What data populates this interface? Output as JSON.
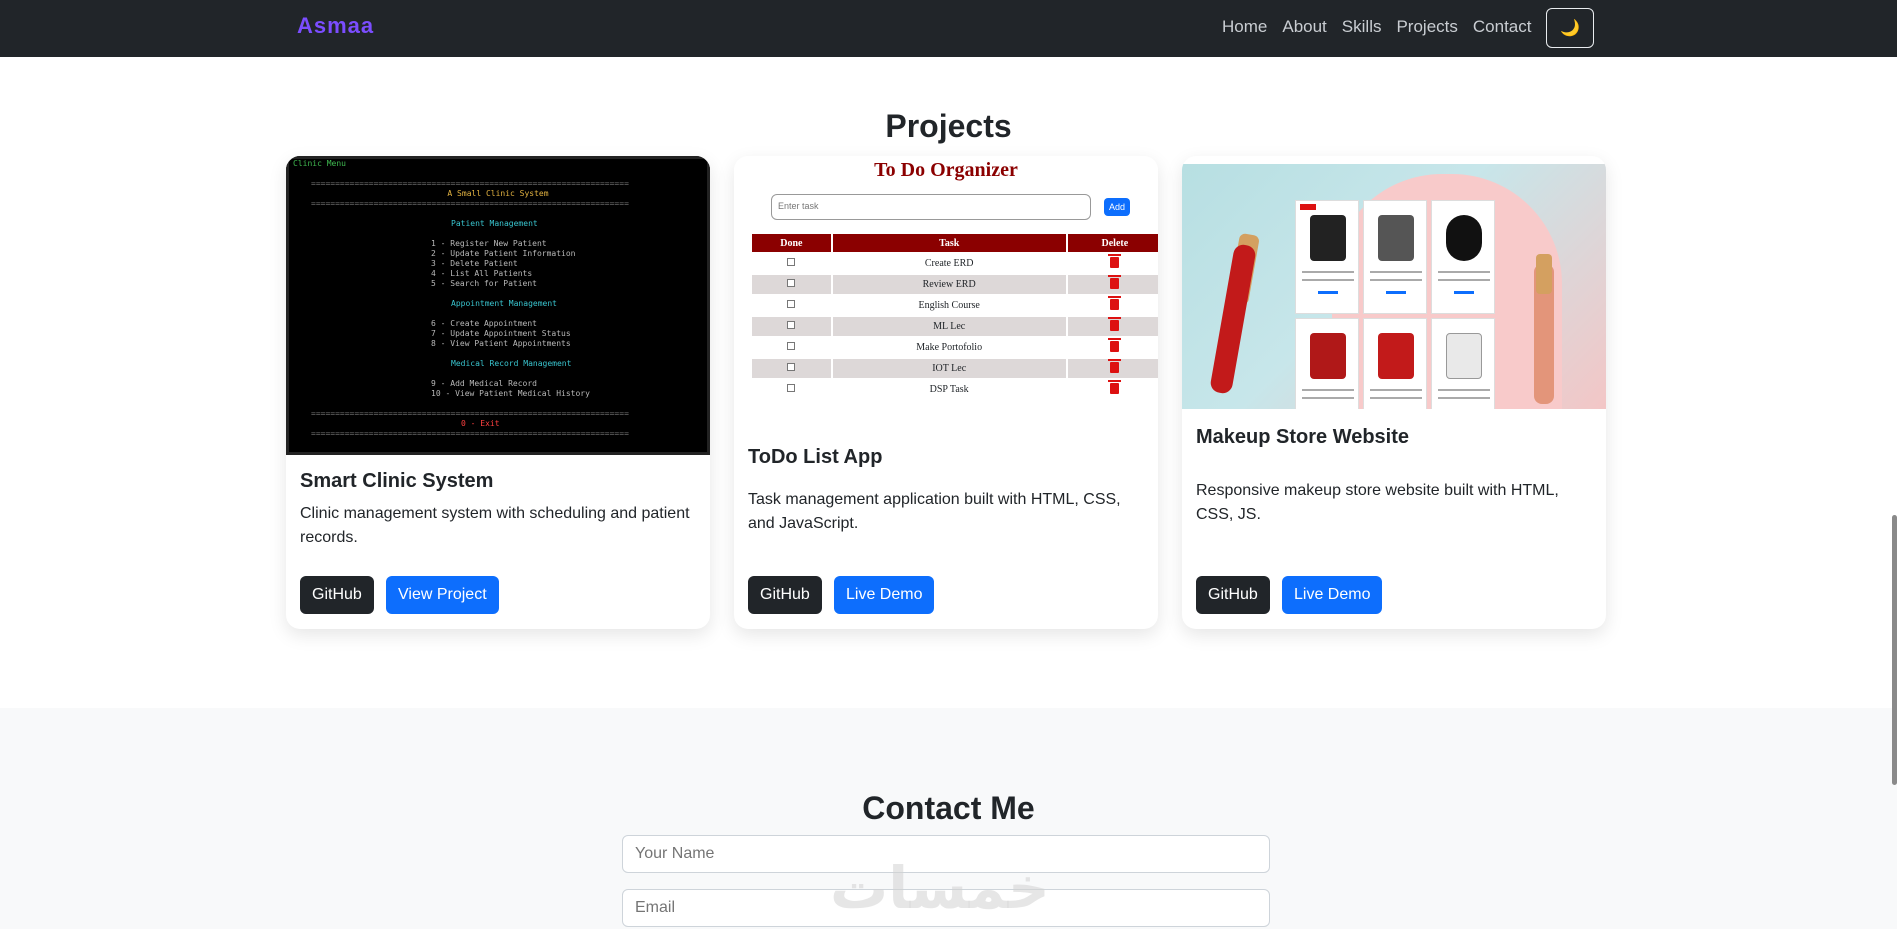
{
  "navbar": {
    "brand": "Asmaa",
    "links": [
      "Home",
      "About",
      "Skills",
      "Projects",
      "Contact"
    ],
    "theme_toggle": "🌙"
  },
  "projects": {
    "title": "Projects",
    "cards": [
      {
        "title": "Smart Clinic System",
        "text": "Clinic management system with scheduling and patient records.",
        "buttons": [
          "GitHub",
          "View Project"
        ],
        "preview": {
          "tag": "Clinic Menu",
          "heading": "A Small Clinic System",
          "lines": [
            "Patient Management",
            "1 - Register New Patient",
            "2 - Update Patient Information",
            "3 - Delete Patient",
            "4 - List All Patients",
            "5 - Search for Patient",
            "Appointment Management",
            "6 - Create Appointment",
            "7 - Update Appointment Status",
            "8 - View Patient Appointments",
            "Medical Record Management",
            "9 - Add Medical Record",
            "10 - View Patient Medical History",
            "0 - Exit"
          ]
        }
      },
      {
        "title": "ToDo List App",
        "text": "Task management application built with HTML, CSS, and JavaScript.",
        "buttons": [
          "GitHub",
          "Live Demo"
        ],
        "preview": {
          "heading": "To Do Organizer",
          "input_placeholder": "Enter task",
          "add_label": "Add",
          "columns": [
            "Done",
            "Task",
            "Delete"
          ],
          "tasks": [
            "Create ERD",
            "Review ERD",
            "English Course",
            "ML Lec",
            "Make Portofolio",
            "IOT Lec",
            "DSP Task"
          ]
        }
      },
      {
        "title": "Makeup Store Website",
        "text": "Responsive makeup store website built with HTML, CSS, JS.",
        "buttons": [
          "GitHub",
          "Live Demo"
        ]
      }
    ]
  },
  "contact": {
    "title": "Contact Me",
    "name_placeholder": "Your Name",
    "email_placeholder": "Email"
  },
  "watermark": "خمسات"
}
